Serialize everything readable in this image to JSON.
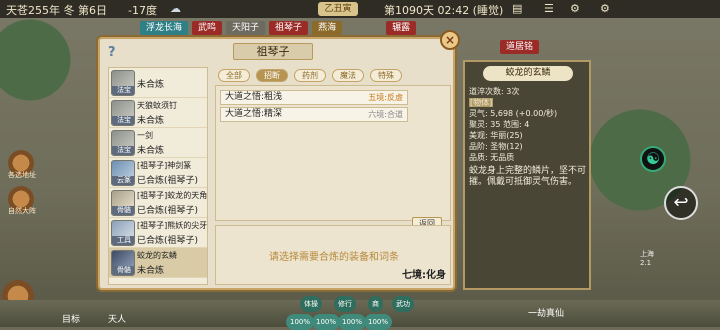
{
  "status_bar": {
    "date_text": "天苍255年 冬 第6日",
    "temperature": "-17度",
    "ribbon": "乙丑寅",
    "day_time": "第1090天 02:42 (睡觉)"
  },
  "map_tiles": {
    "row": [
      "浮龙长海",
      "武鸣",
      "天阳子",
      "祖琴子",
      "燕海",
      "辗露"
    ],
    "row2": [
      "道居铭"
    ]
  },
  "left_hud": [
    {
      "label": "各选地址"
    },
    {
      "label": "自然大阵"
    }
  ],
  "right_hud": {
    "text_lines": [
      "上海",
      "2.1"
    ]
  },
  "bottom_bar": {
    "chips": [
      "体操",
      "修行",
      "商",
      "武功"
    ],
    "left_labels": [
      "目标",
      "天人"
    ],
    "right_text": "一劫真仙",
    "percent_chips": [
      "100%",
      "100%",
      "100%",
      "100%"
    ]
  },
  "dialog": {
    "title": "祖琴子",
    "help_symbol": "?",
    "close_symbol": "×",
    "items": [
      {
        "thumb_tag": "法宝",
        "name": "",
        "state": "未合炼"
      },
      {
        "thumb_tag": "法宝",
        "name": "天狼蚊须钉",
        "state": "未合炼"
      },
      {
        "thumb_tag": "法宝",
        "name": "一剑",
        "state": "未合炼"
      },
      {
        "thumb_tag": "云篆",
        "name": "[祖琴子]神剑篆",
        "state": "已合炼(祖琴子)"
      },
      {
        "thumb_tag": "骨骼",
        "name": "[祖琴子]蛟龙的天角",
        "state": "已合炼(祖琴子)"
      },
      {
        "thumb_tag": "工具",
        "name": "[祖琴子]熊妖的尖牙",
        "state": "已合炼(祖琴子)"
      },
      {
        "thumb_tag": "骨骼",
        "name": "蛟龙的玄鳞",
        "state": "未合炼"
      }
    ],
    "tabs": [
      "全部",
      "招断",
      "药剂",
      "魔法",
      "特殊"
    ],
    "active_tab_index": 1,
    "techniques": [
      {
        "name": "大道之悟:粗浅",
        "requirement": "五境:反虚",
        "req_color": "#c97a1a"
      },
      {
        "name": "大道之悟:精深",
        "requirement": "六境:合道",
        "req_color": "#888888"
      }
    ],
    "return_label": "返回",
    "hint": "请选择需要合炼的装备和词条",
    "realm": "七境:化身"
  },
  "detail": {
    "title": "蛟龙的玄鳞",
    "lines": [
      {
        "label": "道淬次数: 3次",
        "style": "plain"
      },
      {
        "label": "[物体]",
        "style": "tag"
      },
      {
        "label": "灵气: 5,698 (+0.00/秒)",
        "style": "plain"
      },
      {
        "label": "聚灵: 35 范围: 4",
        "style": "plain"
      },
      {
        "label": "美观: 华丽(25)",
        "style": "plain"
      },
      {
        "label": "品阶: 圣物(12)",
        "style": "plain"
      },
      {
        "label": "品质: 无品质",
        "style": "plain"
      }
    ],
    "description": "蛟龙身上完整的鳞片，坚不可摧。佩戴可抵御灵气伤害。"
  },
  "colors": {
    "dialog_bg": "#e7dfc9",
    "dialog_border": "#c9a567",
    "hint_color": "#b7893a",
    "panel_dark": "#4a4636",
    "tab_active": "#b69552"
  }
}
